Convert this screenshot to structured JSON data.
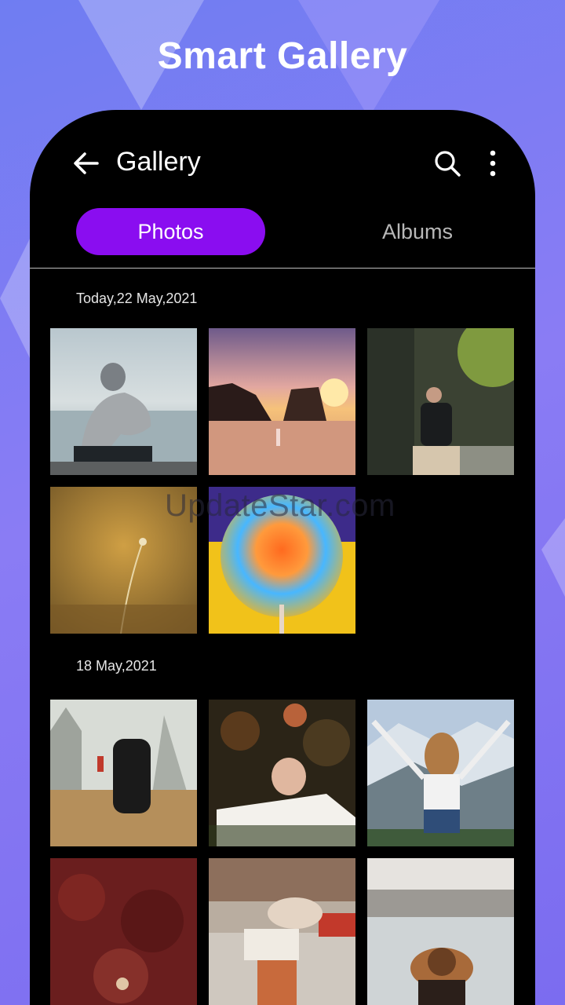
{
  "promo": {
    "title": "Smart Gallery"
  },
  "appbar": {
    "title": "Gallery",
    "icons": [
      "back-arrow-icon",
      "search-icon",
      "more-vertical-icon"
    ]
  },
  "tabs": [
    {
      "label": "Photos",
      "active": true
    },
    {
      "label": "Albums",
      "active": false
    }
  ],
  "sections": [
    {
      "date": "Today,22 May,2021",
      "photo_count": 5
    },
    {
      "date": "18 May,2021",
      "photo_count": 6
    }
  ],
  "watermark": "UpdateStar.com",
  "colors": {
    "accent": "#8a0df0",
    "background": "#000000",
    "promo_bg": "#7b7cf2"
  }
}
